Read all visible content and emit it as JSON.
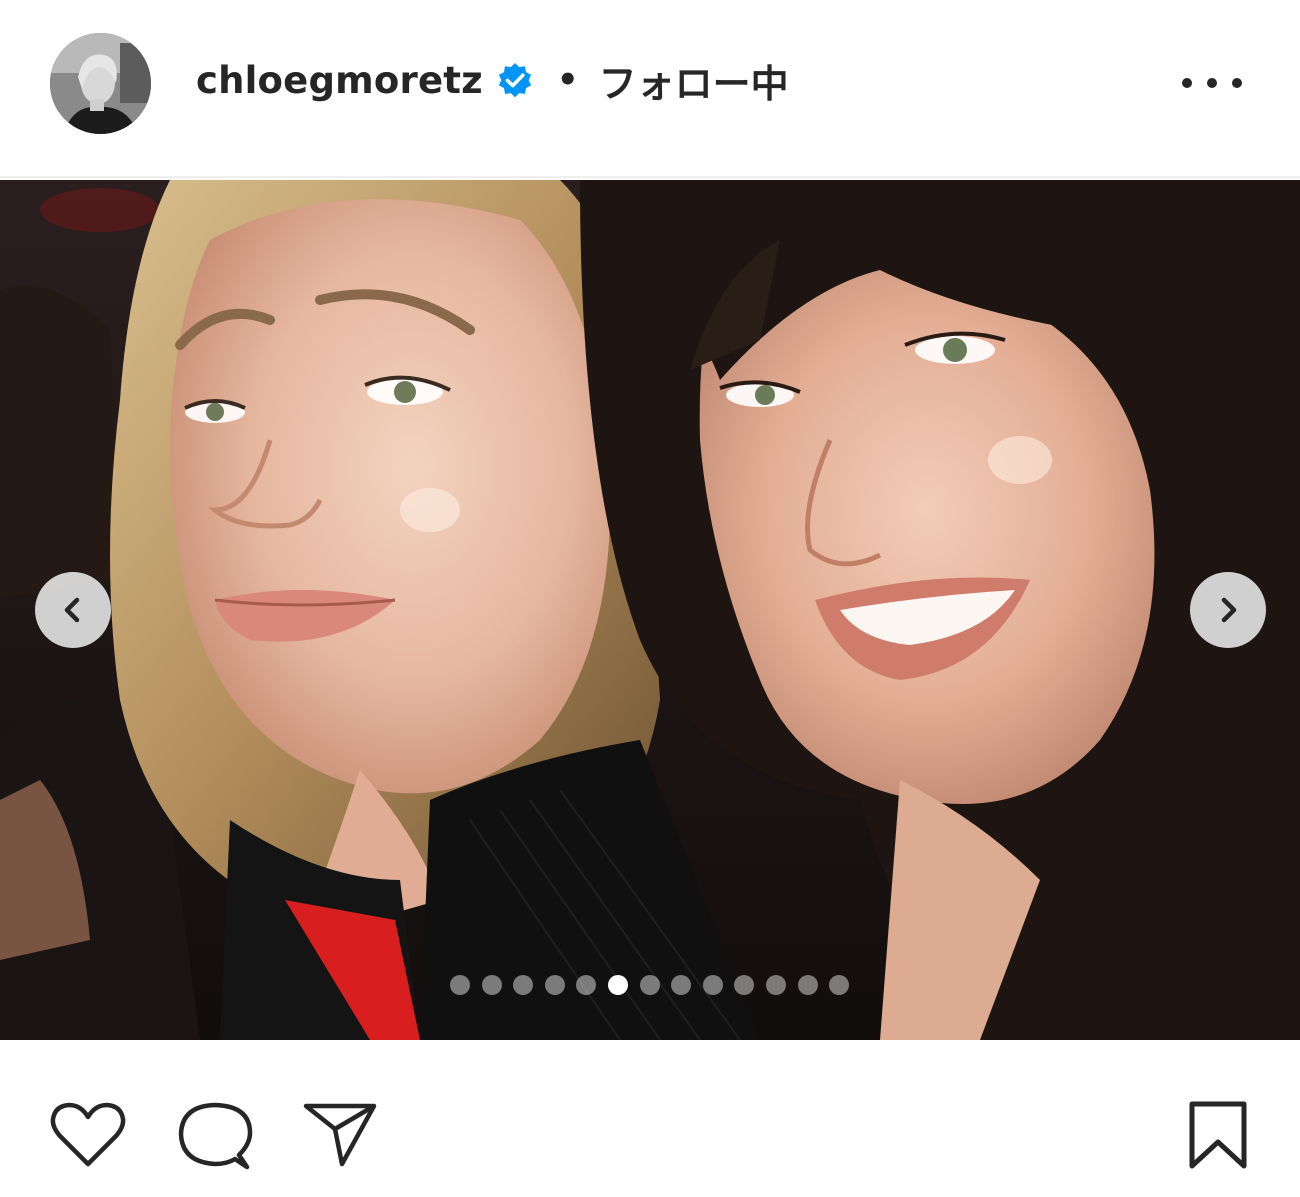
{
  "post": {
    "header": {
      "username": "chloegmoretz",
      "verified": true,
      "separator": "•",
      "follow_status": "フォロー中",
      "more_icon": "more-horizontal-icon"
    },
    "carousel": {
      "total_slides": 13,
      "current_slide": 6,
      "prev_icon": "chevron-left-icon",
      "next_icon": "chevron-right-icon"
    },
    "actions": {
      "like_icon": "heart-icon",
      "comment_icon": "comment-bubble-icon",
      "share_icon": "paper-plane-icon",
      "save_icon": "bookmark-icon"
    }
  },
  "colors": {
    "text": "#262626",
    "verified_badge": "#0095f6",
    "divider": "#efefef",
    "background": "#ffffff"
  }
}
